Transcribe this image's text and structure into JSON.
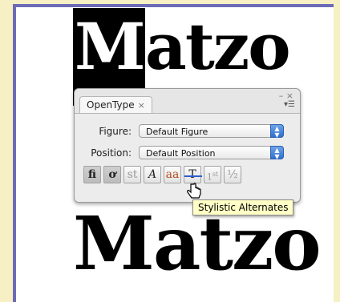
{
  "wordmark_top": "Matzo",
  "wordmark_top_first": "M",
  "wordmark_bottom": "Matzo",
  "panel": {
    "tab_label": "OpenType",
    "tab_close": "×",
    "win_controls": "– ×",
    "menu_glyph": "▾☰",
    "rows": [
      {
        "label": "Figure:",
        "value": "Default Figure"
      },
      {
        "label": "Position:",
        "value": "Default Position"
      }
    ],
    "feature_buttons": [
      "fi",
      "ơ",
      "st",
      "A",
      "aa",
      "T",
      "1st",
      "½"
    ]
  },
  "tooltip": "Stylistic Alternates",
  "colors": {
    "frame": "#6d6bb8",
    "background": "#f6f0c4",
    "accent": "#2f6fce"
  }
}
